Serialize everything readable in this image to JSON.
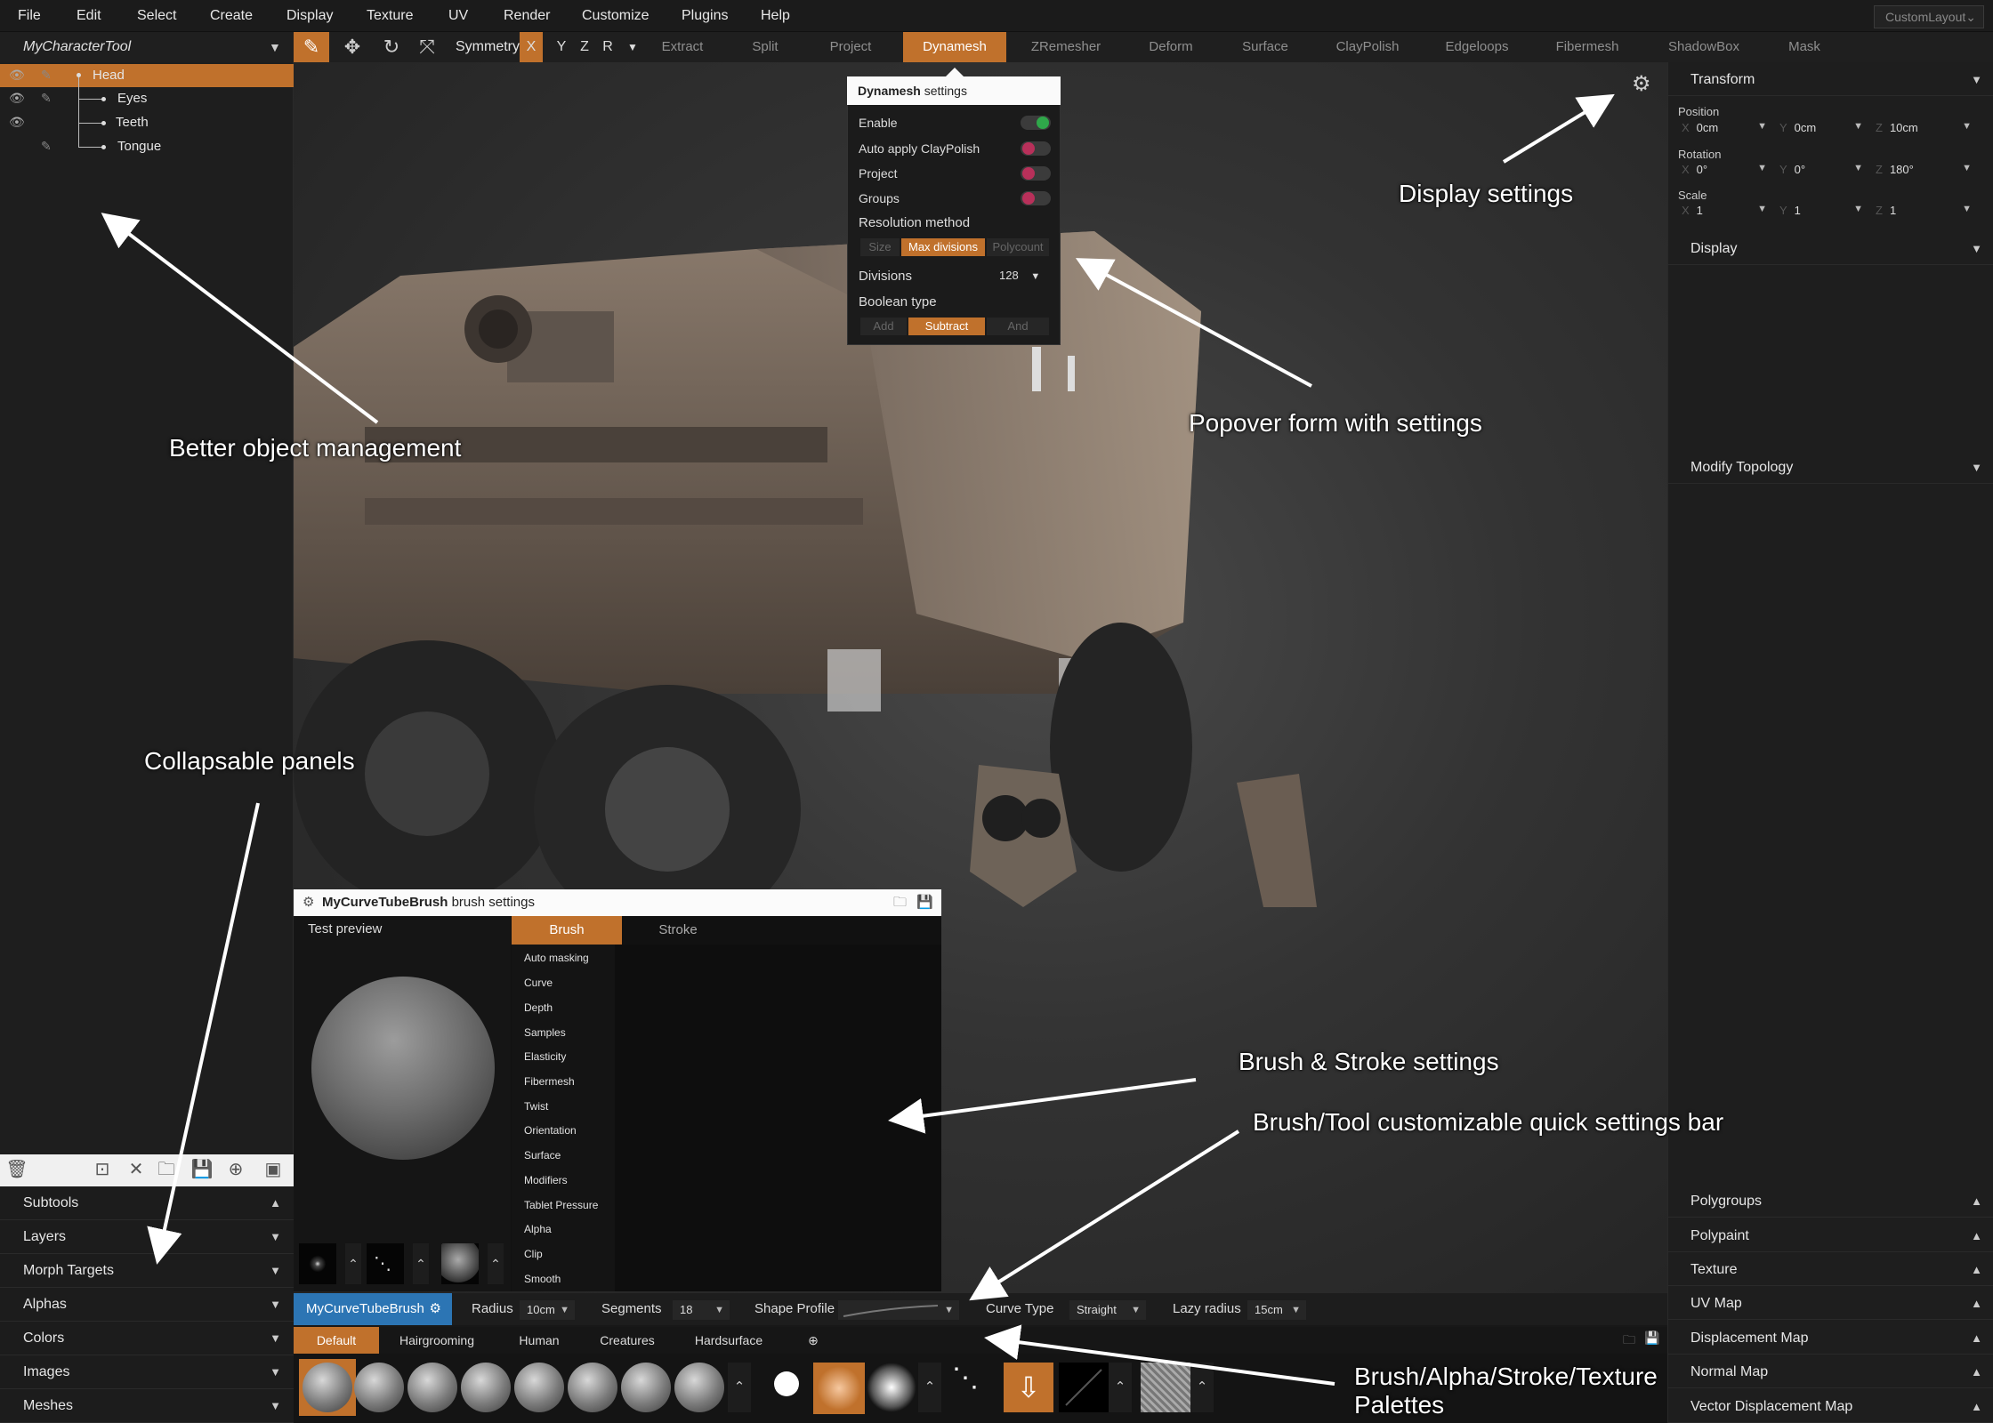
{
  "menu": [
    "File",
    "Edit",
    "Select",
    "Create",
    "Display",
    "Texture",
    "UV",
    "Render",
    "Customize",
    "Plugins",
    "Help"
  ],
  "layout_select": "CustomLayout",
  "tool_name": "MyCharacterTool",
  "symmetry": {
    "label": "Symmetry",
    "axes": [
      "X",
      "Y",
      "Z",
      "R"
    ],
    "active": "X"
  },
  "top_tabs": [
    "Extract",
    "Split",
    "Project",
    "Dynamesh",
    "ZRemesher",
    "Deform",
    "Surface",
    "ClayPolish",
    "Edgeloops",
    "Fibermesh",
    "ShadowBox",
    "Mask"
  ],
  "active_tab": "Dynamesh",
  "outliner": [
    "Head",
    "Eyes",
    "Teeth",
    "Tongue"
  ],
  "left_panels": [
    "Subtools",
    "Layers",
    "Morph Targets",
    "Alphas",
    "Colors",
    "Images",
    "Meshes"
  ],
  "popover": {
    "title_bold": "Dynamesh",
    "title_rest": " settings",
    "enable": "Enable",
    "auto_apply": "Auto apply ClayPolish",
    "project": "Project",
    "groups": "Groups",
    "resolution_method": "Resolution method",
    "resolution_options": [
      "Size",
      "Max divisions",
      "Polycount"
    ],
    "divisions_label": "Divisions",
    "divisions_value": "128",
    "boolean_type": "Boolean type",
    "boolean_options": [
      "Add",
      "Subtract",
      "And"
    ]
  },
  "right": {
    "transform": "Transform",
    "position": "Position",
    "position_values": [
      "0cm",
      "0cm",
      "10cm"
    ],
    "rotation": "Rotation",
    "rotation_values": [
      "0°",
      "0°",
      "180°"
    ],
    "scale": "Scale",
    "scale_values": [
      "1",
      "1",
      "1"
    ],
    "axis_letters": [
      "X",
      "Y",
      "Z"
    ],
    "display": "Display",
    "modify_topology": "Modify Topology",
    "bottom_panels": [
      "Polygroups",
      "Polypaint",
      "Texture",
      "UV Map",
      "Displacement Map",
      "Normal Map",
      "Vector Displacement Map"
    ]
  },
  "brush_dialog": {
    "title_bold": "MyCurveTubeBrush",
    "title_rest": " brush settings",
    "preview_label": "Test preview",
    "tabs": [
      "Brush",
      "Stroke"
    ],
    "categories": [
      "Auto masking",
      "Curve",
      "Depth",
      "Samples",
      "Elasticity",
      "Fibermesh",
      "Twist",
      "Orientation",
      "Surface",
      "Modifiers",
      "Tablet Pressure",
      "Alpha",
      "Clip",
      "Smooth"
    ]
  },
  "quickbar": {
    "brush_name": "MyCurveTubeBrush",
    "radius_label": "Radius",
    "radius_value": "10cm",
    "segments_label": "Segments",
    "segments_value": "18",
    "shape_profile_label": "Shape Profile",
    "curve_type_label": "Curve Type",
    "curve_type_value": "Straight",
    "lazy_radius_label": "Lazy radius",
    "lazy_radius_value": "15cm"
  },
  "palette_tabs": [
    "Default",
    "Hairgrooming",
    "Human",
    "Creatures",
    "Hardsurface"
  ],
  "annotations": {
    "object_mgmt": "Better object management",
    "display_settings": "Display settings",
    "popover": "Popover form with settings",
    "collapsable": "Collapsable panels",
    "brush_stroke": "Brush & Stroke settings",
    "quick_bar": "Brush/Tool customizable quick settings bar",
    "palettes_1": "Brush/Alpha/Stroke/Texture",
    "palettes_2": "Palettes"
  },
  "colors": {
    "accent": "#c0712c",
    "brush_blue": "#2c75b4",
    "toggle_on": "#2fa84a",
    "toggle_off": "#b8305a"
  },
  "icons": [
    "eye-icon",
    "pencil-icon",
    "gear-icon",
    "transform-icon",
    "move-icon",
    "rotate-icon",
    "scale-icon",
    "chevron-down-icon",
    "chevron-up-icon",
    "folder-icon",
    "save-icon",
    "plus-icon"
  ]
}
